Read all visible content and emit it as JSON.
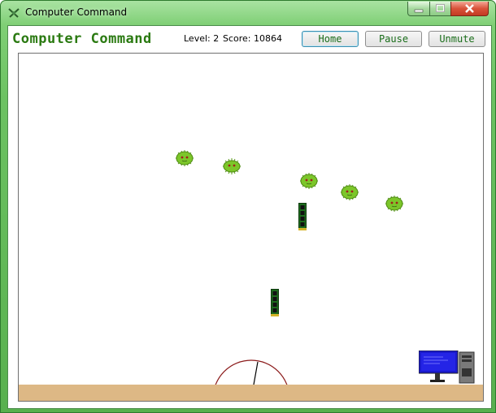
{
  "window": {
    "title": "Computer Command",
    "icon": "crossed-swords-icon",
    "controls": [
      "minimize",
      "maximize",
      "close"
    ]
  },
  "header": {
    "game_title": "Computer Command",
    "level_label": "Level: 2",
    "score_label": "Score: 10864",
    "buttons": {
      "home": "Home",
      "pause": "Pause",
      "unmute": "Unmute"
    }
  },
  "game": {
    "enemies": [
      "virus",
      "virus",
      "virus",
      "virus",
      "virus"
    ],
    "projectiles": [
      "ram-stick",
      "ram-stick"
    ],
    "player": "cannon-turret",
    "base": "desktop-computer",
    "colors": {
      "virus": "#7cc62a",
      "ground": "#ddb885",
      "monitor": "#1a1acc",
      "turret": "#8b1a1a",
      "title": "#2b7a12"
    }
  }
}
